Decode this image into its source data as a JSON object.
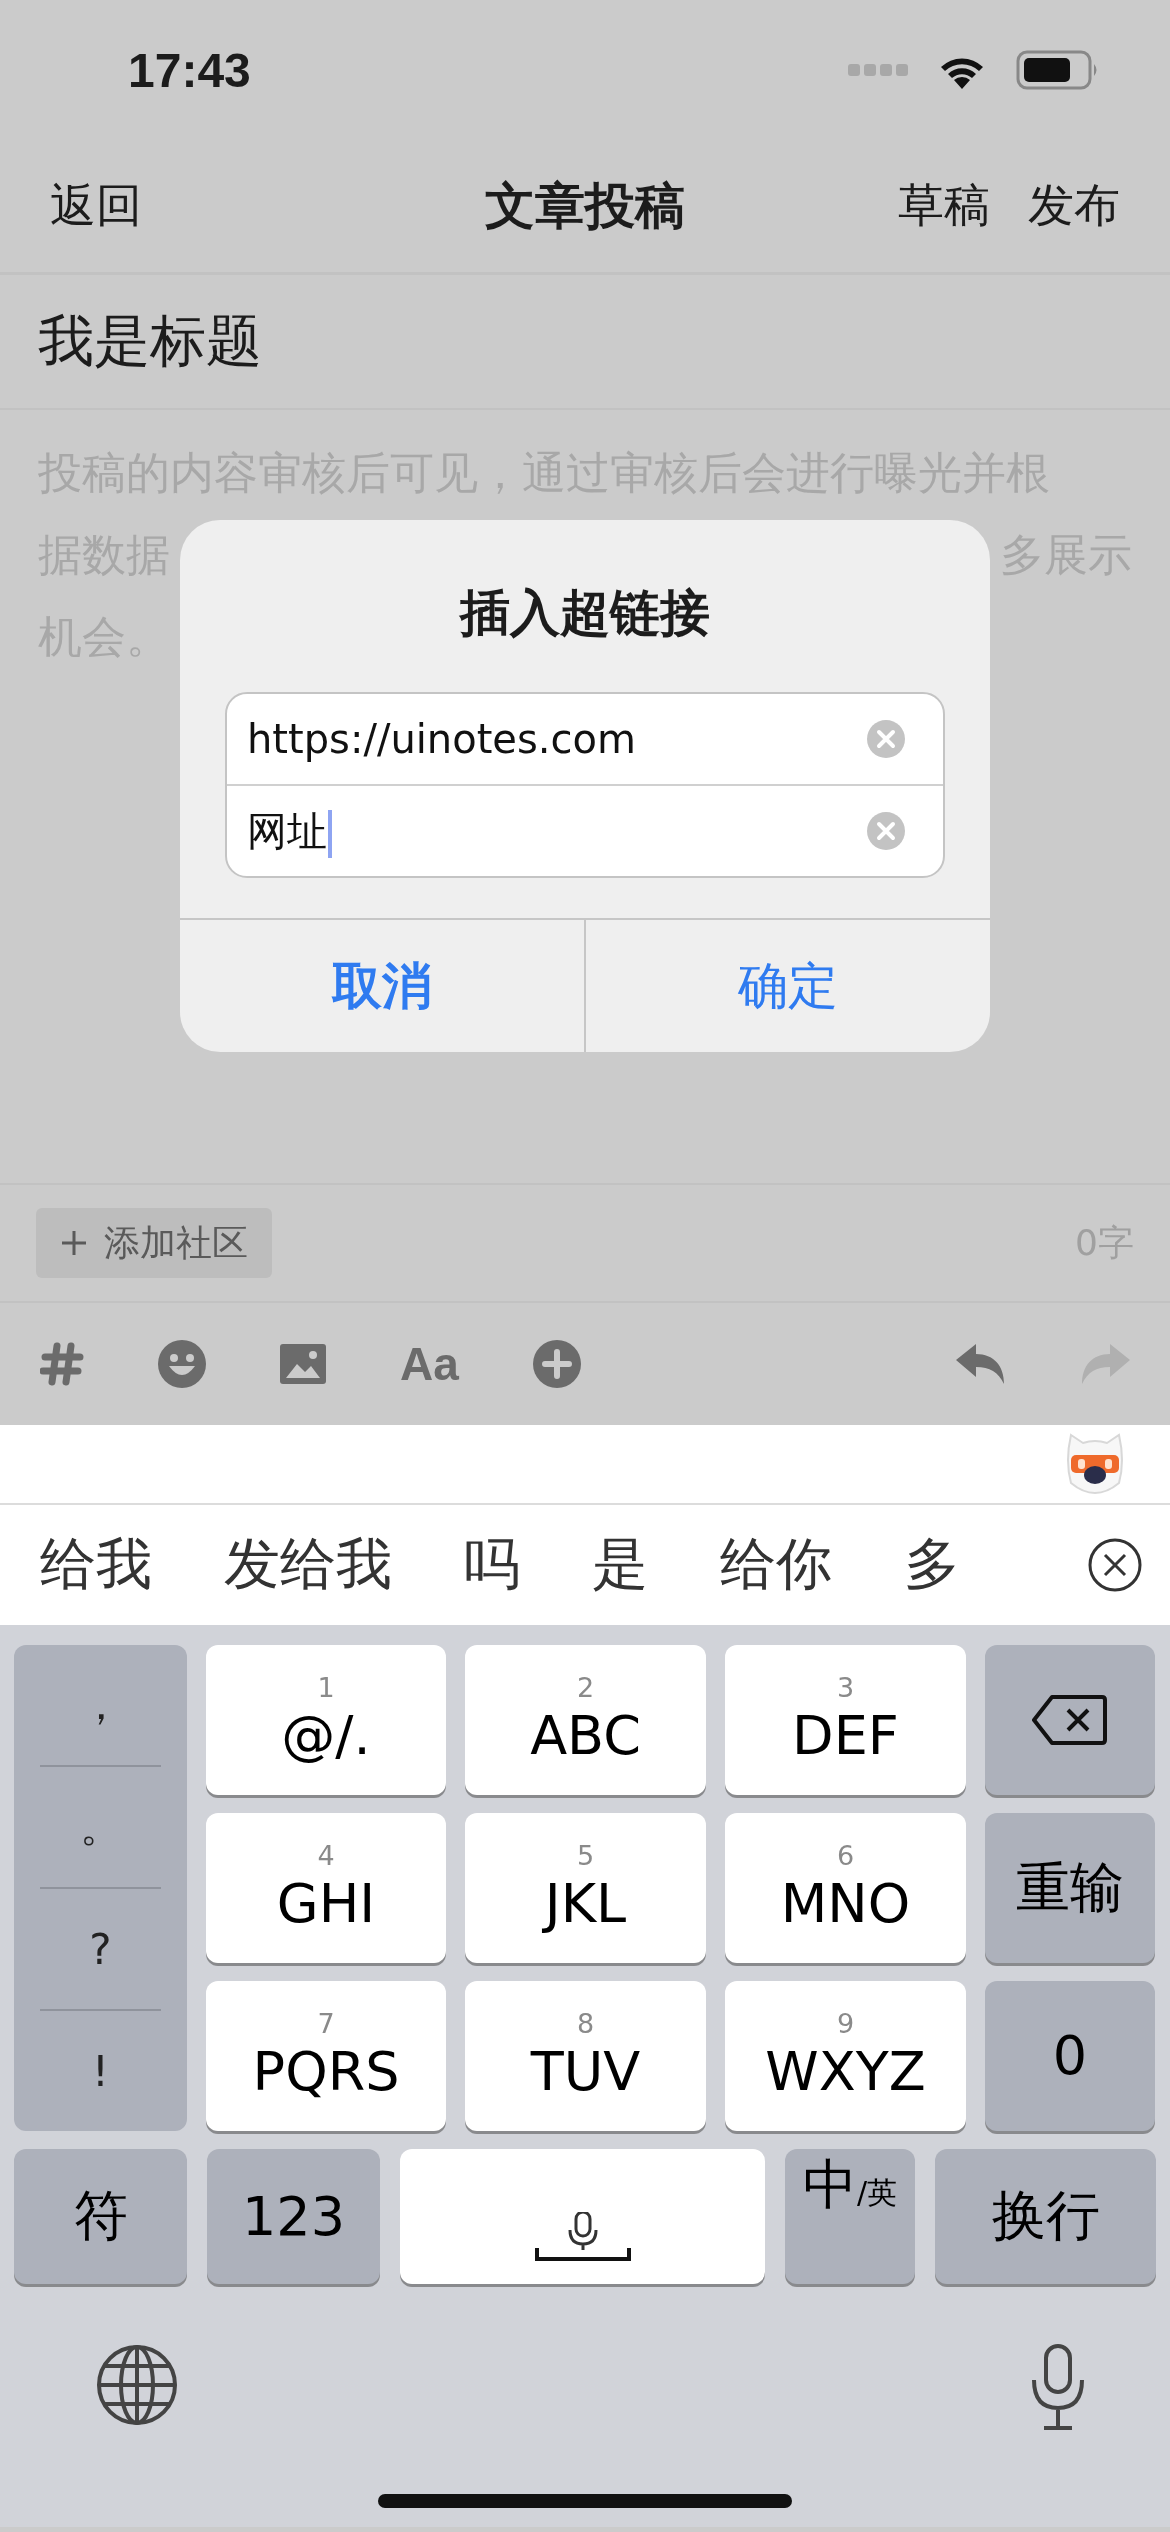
{
  "status_bar": {
    "time": "17:43"
  },
  "nav": {
    "back": "返回",
    "title": "文章投稿",
    "actions": [
      "草稿",
      "发布"
    ]
  },
  "editor": {
    "title": "我是标题",
    "hint_lines": [
      {
        "parts": [
          "投稿的内容审核后可见，通过审核后会进行曝光并根"
        ]
      },
      {
        "parts": [
          "据数据",
          "多展示"
        ]
      },
      {
        "parts": [
          "机会。"
        ]
      }
    ]
  },
  "footer": {
    "community_button": "添加社区",
    "word_count": "0字"
  },
  "toolbar": [
    {
      "kind": "hashtag",
      "disabled": false
    },
    {
      "kind": "emoji",
      "disabled": false
    },
    {
      "kind": "image",
      "disabled": false
    },
    {
      "kind": "text",
      "label": "Aa",
      "disabled": false
    },
    {
      "kind": "add",
      "disabled": false
    },
    {
      "kind": "undo",
      "disabled": false
    },
    {
      "kind": "redo",
      "disabled": true
    }
  ],
  "dialog": {
    "title": "插入超链接",
    "fields": [
      {
        "value": "https://uinotes.com",
        "focused": false
      },
      {
        "value": "网址",
        "focused": true
      }
    ],
    "buttons": [
      {
        "label": "取消",
        "emphasized": true
      },
      {
        "label": "确定",
        "emphasized": false
      }
    ]
  },
  "keyboard": {
    "candidates": [
      "给我",
      "发给我",
      "吗",
      "是",
      "给你",
      "多"
    ],
    "symbols": [
      "，",
      "。",
      "?",
      "!"
    ],
    "keys": [
      {
        "number": "1",
        "letters": "@/."
      },
      {
        "number": "2",
        "letters": "ABC"
      },
      {
        "number": "3",
        "letters": "DEF"
      },
      {
        "number": "4",
        "letters": "GHI"
      },
      {
        "number": "5",
        "letters": "JKL"
      },
      {
        "number": "6",
        "letters": "MNO"
      },
      {
        "number": "7",
        "letters": "PQRS"
      },
      {
        "number": "8",
        "letters": "TUV"
      },
      {
        "number": "9",
        "letters": "WXYZ"
      }
    ],
    "reset": "重输",
    "zero": "0",
    "symbol_key": "符",
    "number_key": "123",
    "lang_main": "中",
    "lang_sub": "/英",
    "return_key": "换行"
  }
}
